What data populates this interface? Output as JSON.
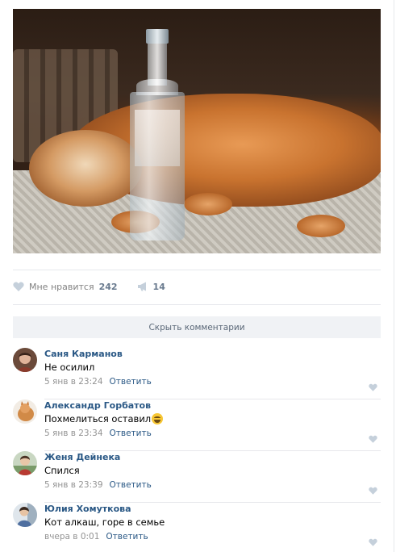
{
  "post": {
    "likes_label": "Мне нравится",
    "likes_count": "242",
    "shares_count": "14",
    "icons": {
      "like": "heart-icon",
      "share": "megaphone-icon"
    },
    "colors": {
      "link": "#2a5885",
      "meta": "#939393",
      "icon": "#c5d0db"
    }
  },
  "comments_toggle": {
    "label": "Скрыть комментарии"
  },
  "comments": [
    {
      "author": "Саня Карманов",
      "text": "Не осилил",
      "date": "5 янв в 23:24",
      "reply": "Ответить"
    },
    {
      "author": "Александр Горбатов",
      "text": "Похмелиться оставил",
      "emoji": "laughing-emoji",
      "date": "5 янв в 23:34",
      "reply": "Ответить"
    },
    {
      "author": "Женя Дейнека",
      "text": "Спился",
      "date": "5 янв в 23:39",
      "reply": "Ответить"
    },
    {
      "author": "Юлия Хомуткова",
      "text": "Кот алкаш, горе в семье",
      "date": "вчера в 0:01",
      "reply": "Ответить"
    }
  ]
}
